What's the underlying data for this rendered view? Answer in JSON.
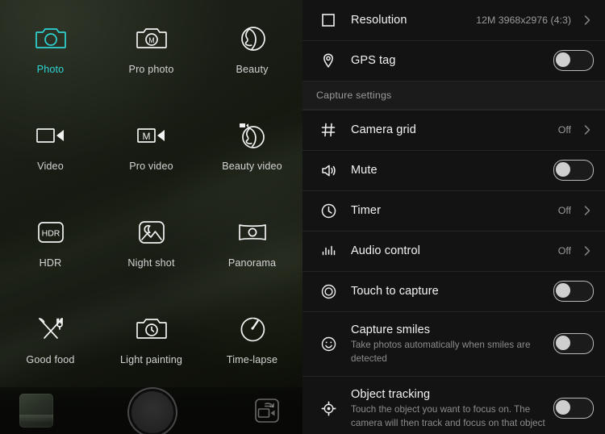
{
  "camera_modes": [
    {
      "label": "Photo",
      "icon": "camera-icon",
      "active": true
    },
    {
      "label": "Pro photo",
      "icon": "camera-manual-icon",
      "active": false
    },
    {
      "label": "Beauty",
      "icon": "face-beauty-icon",
      "active": false
    },
    {
      "label": "Video",
      "icon": "camcorder-icon",
      "active": false
    },
    {
      "label": "Pro video",
      "icon": "camcorder-manual-icon",
      "active": false
    },
    {
      "label": "Beauty video",
      "icon": "face-beauty-video-icon",
      "active": false
    },
    {
      "label": "HDR",
      "icon": "hdr-icon",
      "active": false
    },
    {
      "label": "Night shot",
      "icon": "night-shot-icon",
      "active": false
    },
    {
      "label": "Panorama",
      "icon": "panorama-icon",
      "active": false
    },
    {
      "label": "Good food",
      "icon": "food-cutlery-icon",
      "active": false
    },
    {
      "label": "Light painting",
      "icon": "camera-clock-icon",
      "active": false
    },
    {
      "label": "Time-lapse",
      "icon": "timelapse-icon",
      "active": false
    }
  ],
  "camera_bar": {
    "gallery_thumbnail": "gallery-thumbnail",
    "shutter": "shutter-button",
    "switch": "switch-camera-icon"
  },
  "settings": {
    "section_label": "Capture settings",
    "rows": [
      {
        "title": "Resolution",
        "icon": "square-icon",
        "value": "12M 3968x2976 (4:3)",
        "control": "chevron",
        "desc": ""
      },
      {
        "title": "GPS tag",
        "icon": "location-pin-icon",
        "value": "",
        "control": "toggle",
        "toggle_on": false,
        "desc": ""
      },
      {
        "title": "Camera grid",
        "icon": "grid-icon",
        "value": "Off",
        "control": "chevron",
        "desc": ""
      },
      {
        "title": "Mute",
        "icon": "speaker-icon",
        "value": "",
        "control": "toggle",
        "toggle_on": false,
        "desc": ""
      },
      {
        "title": "Timer",
        "icon": "clock-icon",
        "value": "Off",
        "control": "chevron",
        "desc": ""
      },
      {
        "title": "Audio control",
        "icon": "audio-bars-icon",
        "value": "Off",
        "control": "chevron",
        "desc": ""
      },
      {
        "title": "Touch to capture",
        "icon": "touch-target-icon",
        "value": "",
        "control": "toggle",
        "toggle_on": false,
        "desc": ""
      },
      {
        "title": "Capture smiles",
        "icon": "smiley-icon",
        "value": "",
        "control": "toggle",
        "toggle_on": false,
        "desc": "Take photos automatically when smiles are detected"
      },
      {
        "title": "Object tracking",
        "icon": "crosshair-icon",
        "value": "",
        "control": "toggle",
        "toggle_on": false,
        "desc": "Touch the object you want to focus on. The camera will then track and focus on that object"
      }
    ]
  },
  "colors": {
    "accent": "#2fd4d4",
    "panel_bg": "#131313",
    "section_bg": "#1b1b1b",
    "divider": "#262626",
    "title_text": "#f4f4f4",
    "secondary_text": "#8d8d8d"
  }
}
